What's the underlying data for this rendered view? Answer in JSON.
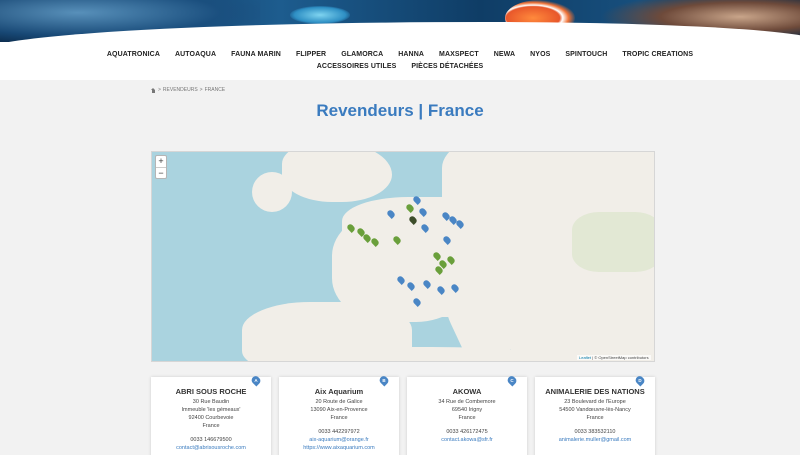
{
  "nav": {
    "row1": [
      "AQUATRONICA",
      "AUTOAQUA",
      "FAUNA MARIN",
      "FLIPPER",
      "GLAMORCA",
      "HANNA",
      "MAXSPECT",
      "NEWA",
      "NYOS",
      "SPINTOUCH",
      "TROPIC CREATIONS"
    ],
    "row2": [
      "ACCESSOIRES UTILES",
      "PIÈCES DÉTACHÉES"
    ]
  },
  "breadcrumb": {
    "separator": ">",
    "items": [
      "REVENDEURS",
      "FRANCE"
    ]
  },
  "title": {
    "part1": "Revendeurs",
    "sep": "|",
    "part2": "France"
  },
  "map": {
    "zoom_in": "+",
    "zoom_out": "−",
    "attribution_link": "Leaflet",
    "attribution_text": "| © OpenStreetMap contributors"
  },
  "dealers": [
    {
      "letter": "A",
      "name": "ABRI SOUS ROCHE",
      "lines": [
        "30 Rue Baudin",
        "Immeuble 'les gémeaux'",
        "92400 Courbevoie",
        "France"
      ],
      "phone": "0033 146679500",
      "links": [
        "contact@abrisousroche.com"
      ]
    },
    {
      "letter": "B",
      "name": "Aix Aquarium",
      "lines": [
        "20 Route de Galice",
        "13090 Aix-en-Provence",
        "France"
      ],
      "phone": "0033 442297972",
      "links": [
        "aix-aquarium@orange.fr",
        "https://www.aixaquarium.com"
      ]
    },
    {
      "letter": "C",
      "name": "AKOWA",
      "lines": [
        "34 Rue de Combemore",
        "69540 Irigny",
        "France"
      ],
      "phone": "0033 426172475",
      "links": [
        "contact.akowa@sfr.fr"
      ]
    },
    {
      "letter": "D",
      "name": "ANIMALERIE DES NATIONS",
      "lines": [
        "23 Boulevard de l'Europe",
        "54500 Vandœuvre-lès-Nancy",
        "France"
      ],
      "phone": "0033 383532110",
      "links": [
        "animalerie.muller@gmail.com"
      ]
    }
  ],
  "colors": {
    "accent": "#3a7bbf",
    "marker_blue": "#4a86c5",
    "marker_green": "#6a9f3b",
    "map_water": "#aad3df",
    "map_land": "#f1eee8"
  }
}
